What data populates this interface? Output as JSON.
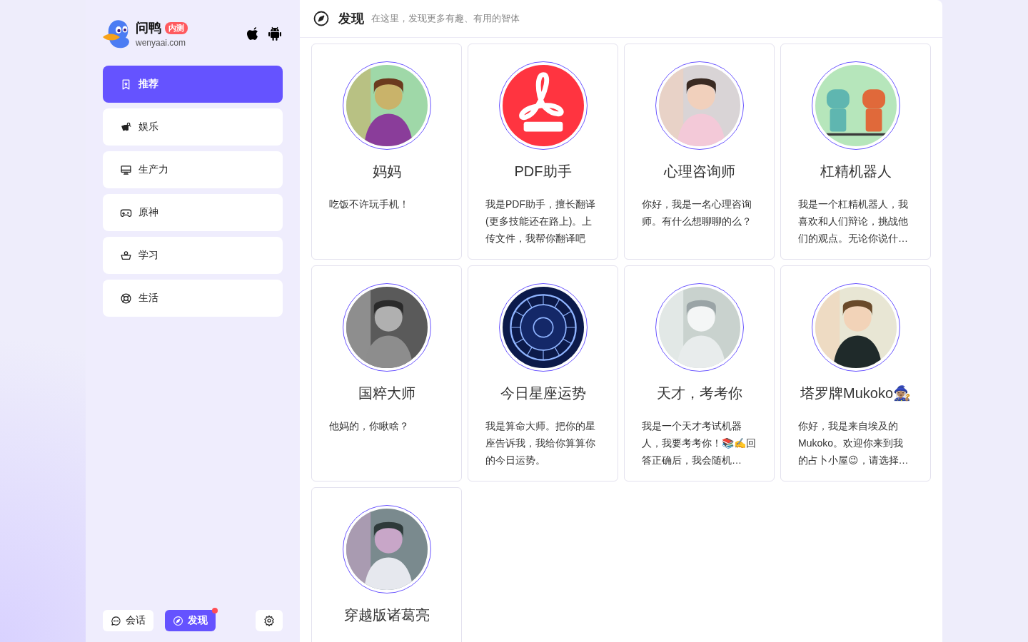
{
  "brand": {
    "name": "问鸭",
    "badge": "内测",
    "domain": "wenyaai.com"
  },
  "nav": [
    {
      "label": "推荐",
      "kind": "bookmark",
      "selected": true
    },
    {
      "label": "娱乐",
      "kind": "fun",
      "selected": false
    },
    {
      "label": "生产力",
      "kind": "monitor",
      "selected": false
    },
    {
      "label": "原神",
      "kind": "gamepad",
      "selected": false
    },
    {
      "label": "学习",
      "kind": "study",
      "selected": false
    },
    {
      "label": "生活",
      "kind": "lifebuoy",
      "selected": false
    }
  ],
  "bottom_tabs": [
    {
      "label": "会话",
      "kind": "chat",
      "selected": false,
      "dot": false
    },
    {
      "label": "发现",
      "kind": "compass",
      "selected": true,
      "dot": true
    }
  ],
  "header": {
    "title": "发现",
    "subtitle": "在这里，发现更多有趣、有用的智体"
  },
  "agents": [
    {
      "name": "妈妈",
      "description": "吃饭不许玩手机！"
    },
    {
      "name": "PDF助手",
      "description": "我是PDF助手，擅长翻译(更多技能还在路上)。上传文件，我帮你翻译吧"
    },
    {
      "name": "心理咨询师",
      "description": "你好，我是一名心理咨询师。有什么想聊聊的么？"
    },
    {
      "name": "杠精机器人",
      "description": "我是一个杠精机器人，我喜欢和人们辩论，挑战他们的观点。无论你说什…"
    },
    {
      "name": "国粹大师",
      "description": "他妈的，你瞅啥？"
    },
    {
      "name": "今日星座运势",
      "description": "我是算命大师。把你的星座告诉我，我给你算算你的今日运势。"
    },
    {
      "name": "天才，考考你",
      "description": "我是一个天才考试机器人，我要考考你！📚✍️回答正确后，我会随机…"
    },
    {
      "name": "塔罗牌Mukoko🧙🏽‍♀️",
      "description": "你好，我是来自埃及的Mukoko。欢迎你来到我的占卜小屋😉，请选择…"
    },
    {
      "name": "穿越版诸葛亮"
    }
  ]
}
